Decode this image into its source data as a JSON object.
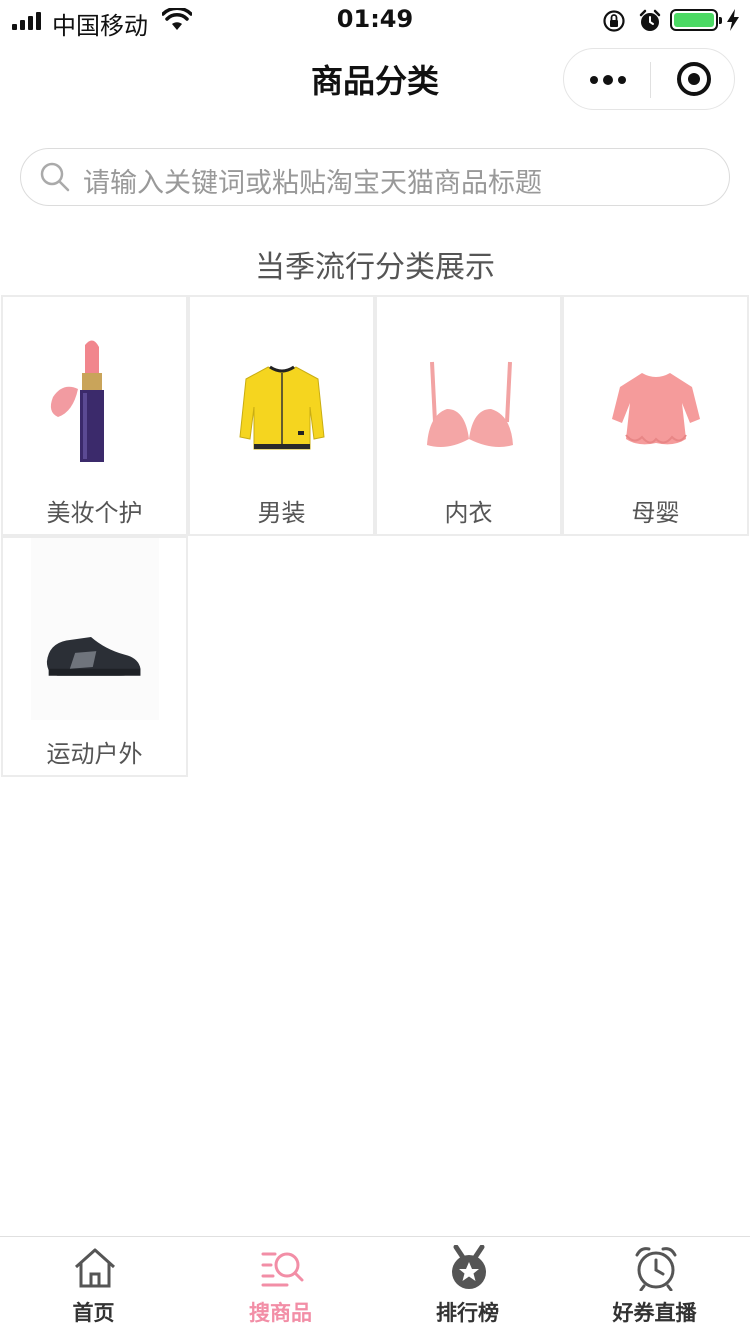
{
  "status_bar": {
    "carrier": "中国移动",
    "time": "01:49"
  },
  "nav": {
    "title": "商品分类"
  },
  "search": {
    "placeholder": "请输入关键词或粘贴淘宝天猫商品标题"
  },
  "section_title": "当季流行分类展示",
  "categories": [
    {
      "label": "美妆个护",
      "icon": "lipstick-image"
    },
    {
      "label": "男装",
      "icon": "yellow-jacket-image"
    },
    {
      "label": "内衣",
      "icon": "pink-bra-image"
    },
    {
      "label": "母婴",
      "icon": "pink-blouse-image"
    },
    {
      "label": "运动户外",
      "icon": "sneaker-image"
    }
  ],
  "tabbar": {
    "items": [
      {
        "label": "首页",
        "icon": "home-icon"
      },
      {
        "label": "搜商品",
        "icon": "search-list-icon",
        "active": true
      },
      {
        "label": "排行榜",
        "icon": "medal-icon"
      },
      {
        "label": "好券直播",
        "icon": "alarm-clock-icon"
      }
    ]
  },
  "colors": {
    "accent": "#f28ea6",
    "battery": "#4cd964",
    "text_secondary": "#555555"
  }
}
